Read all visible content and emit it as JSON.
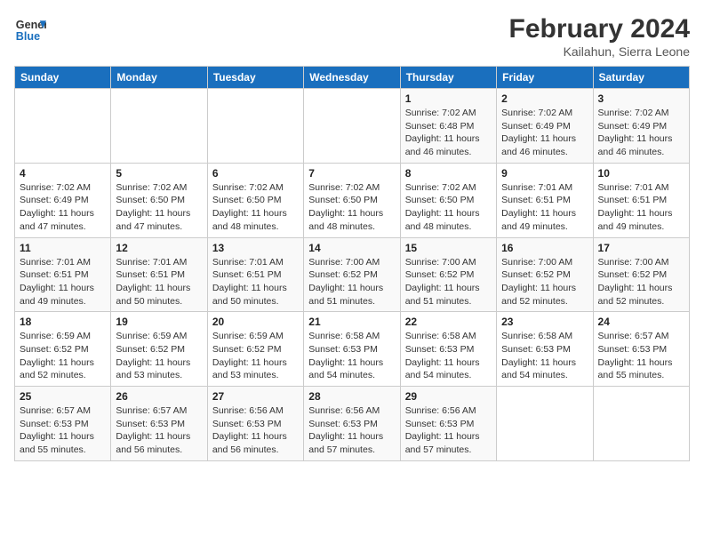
{
  "header": {
    "logo_line1": "General",
    "logo_line2": "Blue",
    "main_title": "February 2024",
    "subtitle": "Kailahun, Sierra Leone"
  },
  "days_of_week": [
    "Sunday",
    "Monday",
    "Tuesday",
    "Wednesday",
    "Thursday",
    "Friday",
    "Saturday"
  ],
  "weeks": [
    [
      {
        "day": "",
        "info": ""
      },
      {
        "day": "",
        "info": ""
      },
      {
        "day": "",
        "info": ""
      },
      {
        "day": "",
        "info": ""
      },
      {
        "day": "1",
        "info": "Sunrise: 7:02 AM\nSunset: 6:48 PM\nDaylight: 11 hours and 46 minutes."
      },
      {
        "day": "2",
        "info": "Sunrise: 7:02 AM\nSunset: 6:49 PM\nDaylight: 11 hours and 46 minutes."
      },
      {
        "day": "3",
        "info": "Sunrise: 7:02 AM\nSunset: 6:49 PM\nDaylight: 11 hours and 46 minutes."
      }
    ],
    [
      {
        "day": "4",
        "info": "Sunrise: 7:02 AM\nSunset: 6:49 PM\nDaylight: 11 hours and 47 minutes."
      },
      {
        "day": "5",
        "info": "Sunrise: 7:02 AM\nSunset: 6:50 PM\nDaylight: 11 hours and 47 minutes."
      },
      {
        "day": "6",
        "info": "Sunrise: 7:02 AM\nSunset: 6:50 PM\nDaylight: 11 hours and 48 minutes."
      },
      {
        "day": "7",
        "info": "Sunrise: 7:02 AM\nSunset: 6:50 PM\nDaylight: 11 hours and 48 minutes."
      },
      {
        "day": "8",
        "info": "Sunrise: 7:02 AM\nSunset: 6:50 PM\nDaylight: 11 hours and 48 minutes."
      },
      {
        "day": "9",
        "info": "Sunrise: 7:01 AM\nSunset: 6:51 PM\nDaylight: 11 hours and 49 minutes."
      },
      {
        "day": "10",
        "info": "Sunrise: 7:01 AM\nSunset: 6:51 PM\nDaylight: 11 hours and 49 minutes."
      }
    ],
    [
      {
        "day": "11",
        "info": "Sunrise: 7:01 AM\nSunset: 6:51 PM\nDaylight: 11 hours and 49 minutes."
      },
      {
        "day": "12",
        "info": "Sunrise: 7:01 AM\nSunset: 6:51 PM\nDaylight: 11 hours and 50 minutes."
      },
      {
        "day": "13",
        "info": "Sunrise: 7:01 AM\nSunset: 6:51 PM\nDaylight: 11 hours and 50 minutes."
      },
      {
        "day": "14",
        "info": "Sunrise: 7:00 AM\nSunset: 6:52 PM\nDaylight: 11 hours and 51 minutes."
      },
      {
        "day": "15",
        "info": "Sunrise: 7:00 AM\nSunset: 6:52 PM\nDaylight: 11 hours and 51 minutes."
      },
      {
        "day": "16",
        "info": "Sunrise: 7:00 AM\nSunset: 6:52 PM\nDaylight: 11 hours and 52 minutes."
      },
      {
        "day": "17",
        "info": "Sunrise: 7:00 AM\nSunset: 6:52 PM\nDaylight: 11 hours and 52 minutes."
      }
    ],
    [
      {
        "day": "18",
        "info": "Sunrise: 6:59 AM\nSunset: 6:52 PM\nDaylight: 11 hours and 52 minutes."
      },
      {
        "day": "19",
        "info": "Sunrise: 6:59 AM\nSunset: 6:52 PM\nDaylight: 11 hours and 53 minutes."
      },
      {
        "day": "20",
        "info": "Sunrise: 6:59 AM\nSunset: 6:52 PM\nDaylight: 11 hours and 53 minutes."
      },
      {
        "day": "21",
        "info": "Sunrise: 6:58 AM\nSunset: 6:53 PM\nDaylight: 11 hours and 54 minutes."
      },
      {
        "day": "22",
        "info": "Sunrise: 6:58 AM\nSunset: 6:53 PM\nDaylight: 11 hours and 54 minutes."
      },
      {
        "day": "23",
        "info": "Sunrise: 6:58 AM\nSunset: 6:53 PM\nDaylight: 11 hours and 54 minutes."
      },
      {
        "day": "24",
        "info": "Sunrise: 6:57 AM\nSunset: 6:53 PM\nDaylight: 11 hours and 55 minutes."
      }
    ],
    [
      {
        "day": "25",
        "info": "Sunrise: 6:57 AM\nSunset: 6:53 PM\nDaylight: 11 hours and 55 minutes."
      },
      {
        "day": "26",
        "info": "Sunrise: 6:57 AM\nSunset: 6:53 PM\nDaylight: 11 hours and 56 minutes."
      },
      {
        "day": "27",
        "info": "Sunrise: 6:56 AM\nSunset: 6:53 PM\nDaylight: 11 hours and 56 minutes."
      },
      {
        "day": "28",
        "info": "Sunrise: 6:56 AM\nSunset: 6:53 PM\nDaylight: 11 hours and 57 minutes."
      },
      {
        "day": "29",
        "info": "Sunrise: 6:56 AM\nSunset: 6:53 PM\nDaylight: 11 hours and 57 minutes."
      },
      {
        "day": "",
        "info": ""
      },
      {
        "day": "",
        "info": ""
      }
    ]
  ]
}
